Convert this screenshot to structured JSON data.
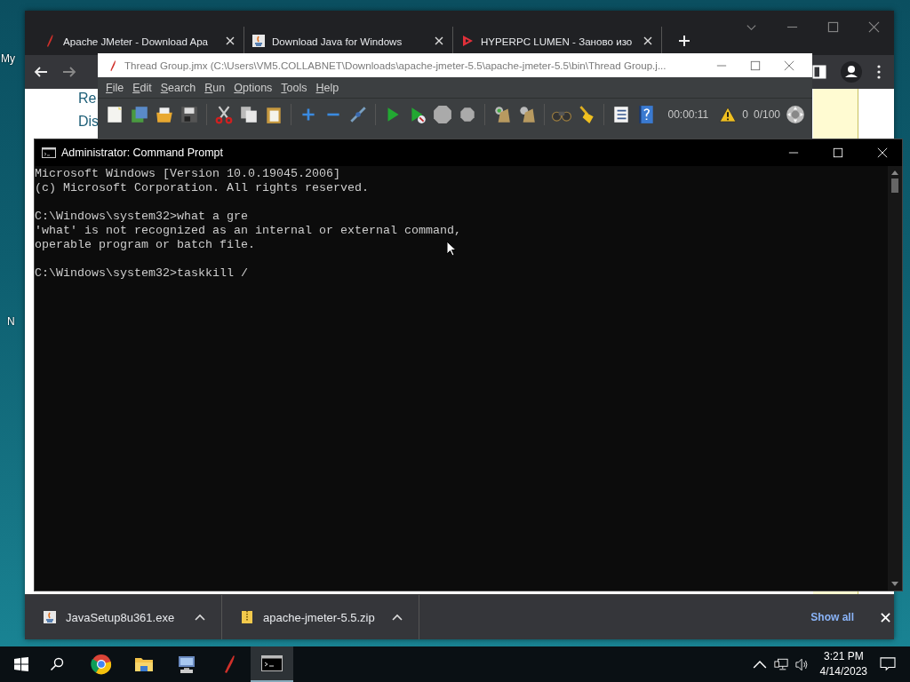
{
  "desktop": {
    "icon_labels": [
      "My",
      "N"
    ]
  },
  "browser": {
    "tabs": [
      {
        "title": "Apache JMeter - Download Apa",
        "kind": "feather"
      },
      {
        "title": "Download Java for Windows",
        "kind": "java"
      },
      {
        "title": "HYPERPC LUMEN - Заново изо",
        "kind": "play"
      }
    ],
    "page_text": [
      "Re",
      "Dis"
    ],
    "downloads": [
      {
        "file": "JavaSetup8u361.exe",
        "kind": "java"
      },
      {
        "file": "apache-jmeter-5.5.zip",
        "kind": "zip"
      }
    ],
    "show_all": "Show all"
  },
  "jmeter": {
    "title": "Thread Group.jmx (C:\\Users\\VM5.COLLABNET\\Downloads\\apache-jmeter-5.5\\apache-jmeter-5.5\\bin\\Thread Group.j...",
    "menu": [
      "File",
      "Edit",
      "Search",
      "Run",
      "Options",
      "Tools",
      "Help"
    ],
    "timer": "00:00:11",
    "warnings": "0",
    "threads": "0/100"
  },
  "cmd": {
    "title": "Administrator:  Command Prompt",
    "blocks": [
      [
        "Microsoft Windows [Version 10.0.19045.2006]",
        "(c) Microsoft Corporation. All rights reserved."
      ],
      [
        "C:\\Windows\\system32>what a gre",
        "'what' is not recognized as an internal or external command,",
        "operable program or batch file."
      ],
      [
        "C:\\Windows\\system32>taskkill /"
      ]
    ]
  },
  "taskbar": {
    "apps": [
      {
        "kind": "chrome",
        "active": false
      },
      {
        "kind": "folder",
        "active": false
      },
      {
        "kind": "network",
        "active": false
      },
      {
        "kind": "feather",
        "active": false
      },
      {
        "kind": "console",
        "active": true
      }
    ],
    "time": "3:21 PM",
    "date": "4/14/2023"
  }
}
